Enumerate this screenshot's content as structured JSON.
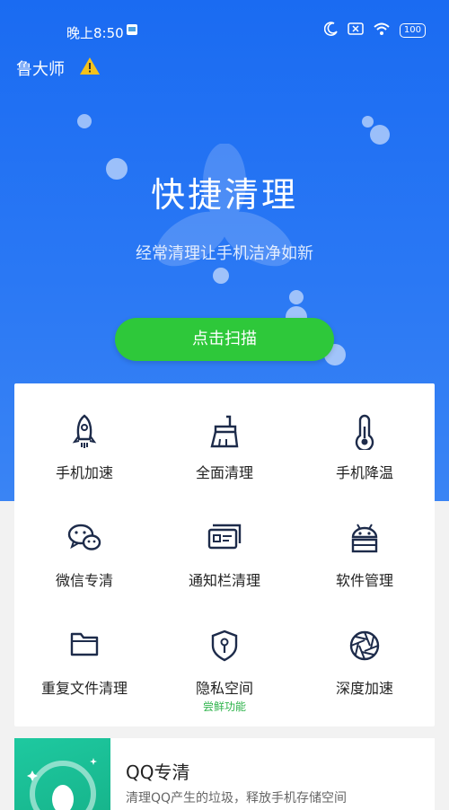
{
  "status_bar": {
    "time": "晚上8:50",
    "battery": "100"
  },
  "app": {
    "name": "鲁大师"
  },
  "hero": {
    "title": "快捷清理",
    "subtitle": "经常清理让手机洁净如新",
    "scan_button": "点击扫描"
  },
  "tools": [
    {
      "label": "手机加速",
      "icon": "rocket-icon"
    },
    {
      "label": "全面清理",
      "icon": "brush-icon"
    },
    {
      "label": "手机降温",
      "icon": "thermometer-icon"
    },
    {
      "label": "微信专清",
      "icon": "wechat-icon"
    },
    {
      "label": "通知栏清理",
      "icon": "notification-card-icon"
    },
    {
      "label": "软件管理",
      "icon": "android-icon"
    },
    {
      "label": "重复文件清理",
      "icon": "folder-icon"
    },
    {
      "label": "隐私空间",
      "icon": "shield-key-icon",
      "badge": "尝鲜功能"
    },
    {
      "label": "深度加速",
      "icon": "aperture-icon"
    }
  ],
  "qq_card": {
    "title": "QQ专清",
    "description": "清理QQ产生的垃圾，释放手机存储空间"
  },
  "colors": {
    "hero_blue": "#1a6bf2",
    "scan_green": "#2ec83a",
    "badge_green": "#2db34a",
    "qq_teal": "#1ec9a0"
  }
}
